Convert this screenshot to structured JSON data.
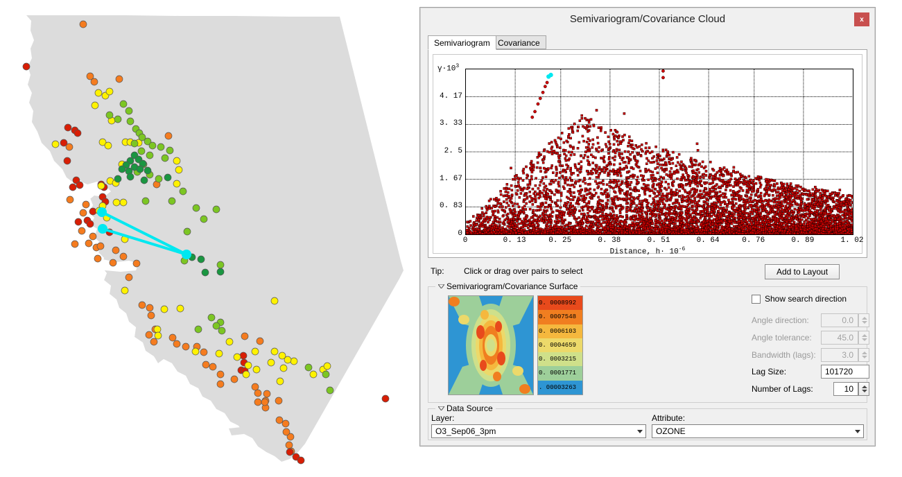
{
  "dialog": {
    "title": "Semivariogram/Covariance Cloud",
    "close_label": "x",
    "close_color": "#c8504f"
  },
  "tabs": [
    {
      "label": "Semivariogram",
      "active": true
    },
    {
      "label": "Covariance",
      "active": false
    }
  ],
  "tip": {
    "key": "Tip:",
    "text": "Click or drag over pairs to select"
  },
  "buttons": {
    "add_to_layout": "Add to Layout"
  },
  "surface_section": {
    "title": "Semivariogram/Covariance Surface",
    "legend_values": [
      "0. 0008992",
      "0. 0007548",
      "0. 0006103",
      "0. 0004659",
      "0. 0003215",
      "0. 0001771",
      ". 00003263"
    ],
    "legend_colors": [
      "#e84a1c",
      "#f07e20",
      "#f5b83e",
      "#ecd96a",
      "#cfe08a",
      "#9dcf9a",
      "#2e95d3"
    ]
  },
  "search_direction": {
    "checkbox_label": "Show search direction",
    "checked": false,
    "fields": [
      {
        "label": "Angle direction:",
        "value": "0.0",
        "enabled": false,
        "spinner": true
      },
      {
        "label": "Angle tolerance:",
        "value": "45.0",
        "enabled": false,
        "spinner": true
      },
      {
        "label": "Bandwidth (lags):",
        "value": "3.0",
        "enabled": false,
        "spinner": true
      },
      {
        "label": "Lag Size:",
        "value": "101720",
        "enabled": true,
        "spinner": false
      },
      {
        "label": "Number of Lags:",
        "value": "10",
        "enabled": true,
        "spinner": true
      }
    ]
  },
  "data_source": {
    "title": "Data Source",
    "layer_label": "Layer:",
    "layer_value": "O3_Sep06_3pm",
    "attribute_label": "Attribute:",
    "attribute_value": "OZONE"
  },
  "map": {
    "landmass_color": "#dcdcdc",
    "background_color": "#ffffff",
    "selection_color": "#00e8f0",
    "point_colors": [
      "#d81e05",
      "#f57c1f",
      "#fff200",
      "#7cc623",
      "#1a9641"
    ],
    "selected_pair_count": 2
  },
  "chart_data": {
    "type": "scatter",
    "title": "",
    "xlabel": "Distance, h· 10-6",
    "ylabel": "γ ·10 3",
    "xticks": [
      0,
      0.13,
      0.25,
      0.38,
      0.51,
      0.64,
      0.76,
      0.89,
      1.02
    ],
    "xticklabels": [
      "0",
      "0. 13",
      "0. 25",
      "0. 38",
      "0. 51",
      "0. 64",
      "0. 76",
      "0. 89",
      "1. 02"
    ],
    "yticks": [
      0,
      0.83,
      1.67,
      2.5,
      3.33,
      4.17
    ],
    "yticklabels": [
      "0",
      "0. 83",
      "1. 67",
      "2. 5",
      "3. 33",
      "4. 17"
    ],
    "xlim": [
      0,
      1.02
    ],
    "ylim": [
      0,
      5.0
    ],
    "grid": true,
    "point_color": "#cc0000",
    "selected_point_color": "#00e8f0",
    "series": [
      {
        "name": "semivariogram cloud pairs",
        "point_count": 7200,
        "description": "dense red cloud, density highest near y=0, envelope rising from x=0 to x~0.3 then tapering toward x=1.02"
      },
      {
        "name": "selected pairs",
        "color": "#00e8f0",
        "points": [
          [
            0.218,
            4.78
          ],
          [
            0.224,
            4.83
          ]
        ]
      }
    ]
  }
}
